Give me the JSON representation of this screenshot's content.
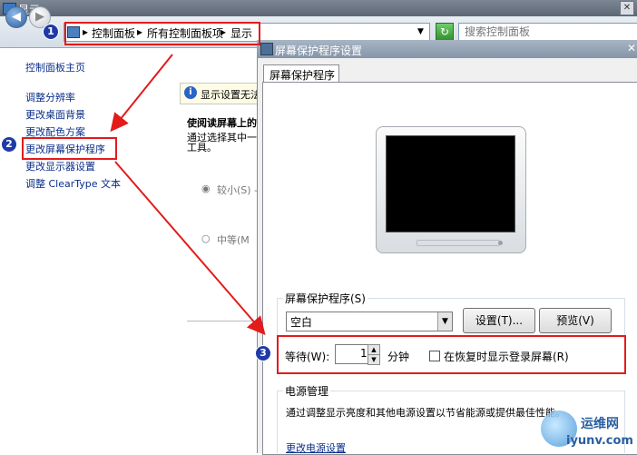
{
  "window": {
    "title": "显示"
  },
  "nav": {
    "back_glyph": "◀",
    "forward_glyph": "▶",
    "breadcrumb": [
      "控制面板",
      "所有控制面板项",
      "显示"
    ],
    "refresh_glyph": "↻",
    "search_placeholder": "搜索控制面板"
  },
  "sidebar": {
    "home": "控制面板主页",
    "items": [
      "调整分辨率",
      "更改桌面背景",
      "更改配色方案",
      "更改屏幕保护程序",
      "更改显示器设置",
      "调整 ClearType 文本"
    ]
  },
  "main": {
    "info": "显示设置无法",
    "heading": "使阅读屏幕上的",
    "desc_line1": "通过选择其中一",
    "desc_line2": "工具。",
    "option_small": "较小(S) -",
    "option_medium": "中等(M"
  },
  "dialog": {
    "title": "屏幕保护程序设置",
    "tab": "屏幕保护程序",
    "screensaver_group": "屏幕保护程序(S)",
    "screensaver_value": "空白",
    "settings_button": "设置(T)...",
    "preview_button": "预览(V)",
    "wait_label": "等待(W):",
    "wait_value": "1",
    "wait_unit": "分钟",
    "resume_label": "在恢复时显示登录屏幕(R)",
    "power_group": "电源管理",
    "power_desc": "通过调整显示亮度和其他电源设置以节省能源或提供最佳性能。",
    "power_link": "更改电源设置"
  },
  "annotations": {
    "badges": [
      "1",
      "2",
      "3"
    ],
    "color": "#e31b1b"
  },
  "watermark": {
    "text_cn": "运维网",
    "text_en": "iyunv.com"
  }
}
